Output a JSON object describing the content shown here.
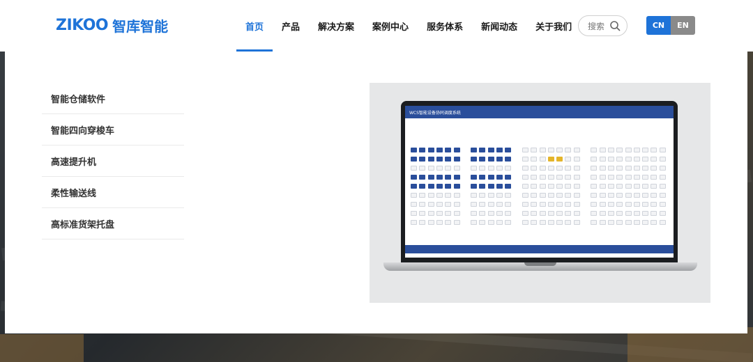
{
  "header": {
    "logo_mark": "ZIKOO",
    "logo_cn": "智库智能",
    "nav": [
      {
        "label": "首页",
        "active": true
      },
      {
        "label": "产品",
        "active": false
      },
      {
        "label": "解决方案",
        "active": false
      },
      {
        "label": "案例中心",
        "active": false
      },
      {
        "label": "服务体系",
        "active": false
      },
      {
        "label": "新闻动态",
        "active": false
      },
      {
        "label": "关于我们",
        "active": false
      }
    ],
    "search_placeholder": "搜索",
    "search_icon": "search-icon",
    "lang": {
      "cn": "CN",
      "en": "EN",
      "active": "CN"
    }
  },
  "dropdown": {
    "items": [
      {
        "label": "智能仓储软件"
      },
      {
        "label": "智能四向穿梭车"
      },
      {
        "label": "高速提升机"
      },
      {
        "label": "柔性输送线"
      },
      {
        "label": "高标准货架托盘"
      }
    ],
    "preview_screen_title": "WCS智能设备协同调度系统"
  },
  "colors": {
    "accent": "#1e73d8",
    "app_blue": "#2a4e9b",
    "lang_en": "#8a8a8a"
  }
}
